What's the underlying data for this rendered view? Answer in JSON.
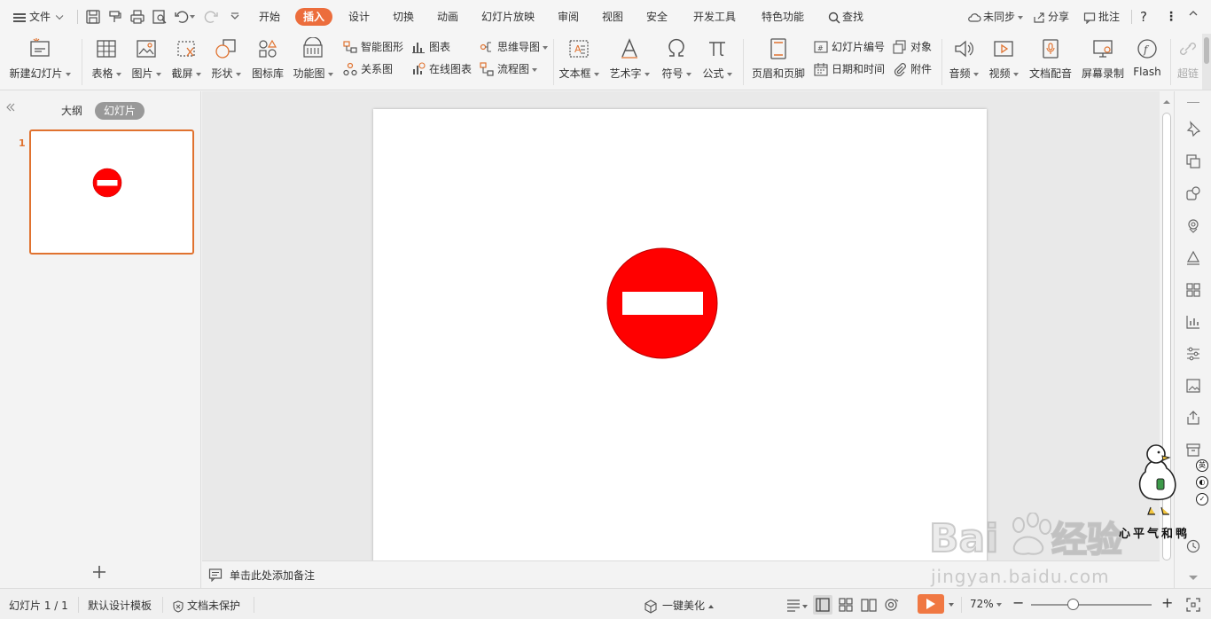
{
  "menubar": {
    "file_menu": "文件",
    "tabs": [
      "开始",
      "插入",
      "设计",
      "切换",
      "动画",
      "幻灯片放映",
      "审阅",
      "视图",
      "安全",
      "开发工具",
      "特色功能"
    ],
    "active_tab": "插入",
    "search": "查找",
    "sync": "未同步",
    "share": "分享",
    "comment": "批注",
    "help_icon": "question-icon",
    "more_icon": "more-vertical-icon"
  },
  "ribbon": {
    "new_slide": "新建幻灯片",
    "table": "表格",
    "picture": "图片",
    "screenshot": "截屏",
    "shape": "形状",
    "icon_library": "图标库",
    "function_chart": "功能图",
    "smart_graphic": "智能图形",
    "chart": "图表",
    "relation": "关系图",
    "online_chart": "在线图表",
    "mind_map": "思维导图",
    "flow_chart": "流程图",
    "text_box": "文本框",
    "art_text": "艺术字",
    "symbol": "符号",
    "formula": "公式",
    "header_footer": "页眉和页脚",
    "slide_number": "幻灯片编号",
    "object": "对象",
    "date_time": "日期和时间",
    "attachment": "附件",
    "audio": "音频",
    "video": "视频",
    "doc_dubbing": "文档配音",
    "screen_record": "屏幕录制",
    "flash": "Flash",
    "hyperlink": "超链"
  },
  "left_panel": {
    "tab_outline": "大纲",
    "tab_slides": "幻灯片",
    "active_tab": "幻灯片",
    "slides": [
      {
        "number": "1"
      }
    ]
  },
  "canvas": {
    "shape": "no-entry-sign",
    "shape_fill": "#ff0000",
    "bar_fill": "#ffffff"
  },
  "notes": {
    "placeholder": "单击此处添加备注"
  },
  "status": {
    "slide_indicator": "幻灯片 1 / 1",
    "template": "默认设计模板",
    "protection": "文档未保护",
    "beautify": "一键美化",
    "zoom": "72%"
  },
  "overlay": {
    "duck_caption": "心平气和鸭",
    "badges": [
      "英",
      "◐",
      "✓"
    ],
    "watermark_logo": "Baidu经验",
    "watermark_url": "jingyan.baidu.com"
  },
  "colors": {
    "accent": "#ec6d3c",
    "thumb_border": "#e0722f",
    "play": "#f07843"
  }
}
